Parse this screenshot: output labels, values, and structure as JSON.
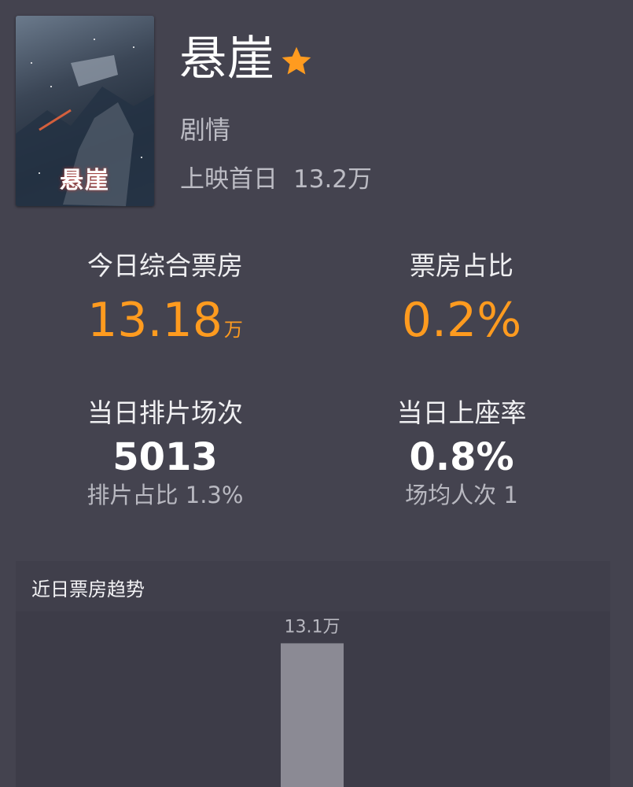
{
  "movie": {
    "title": "悬崖",
    "genre": "剧情",
    "release_label": "上映首日",
    "release_value": "13.2万",
    "poster_title": "悬崖"
  },
  "stats": {
    "box_office_label": "今日综合票房",
    "box_office_value": "13.18",
    "box_office_unit": "万",
    "share_label": "票房占比",
    "share_value": "0.2%",
    "screenings_label": "当日排片场次",
    "screenings_value": "5013",
    "screenings_sub": "排片占比 1.3%",
    "occupancy_label": "当日上座率",
    "occupancy_value": "0.8%",
    "occupancy_sub": "场均人次 1"
  },
  "trend": {
    "title": "近日票房趋势"
  },
  "chart_data": {
    "type": "bar",
    "categories": [
      ""
    ],
    "values": [
      13.1
    ],
    "data_labels": [
      "13.1万"
    ],
    "ylim": [
      0,
      16
    ]
  },
  "colors": {
    "background": "#44434f",
    "accent": "#ff9b1f",
    "bar": "#8b8a94",
    "star": "#ff9b1f"
  }
}
